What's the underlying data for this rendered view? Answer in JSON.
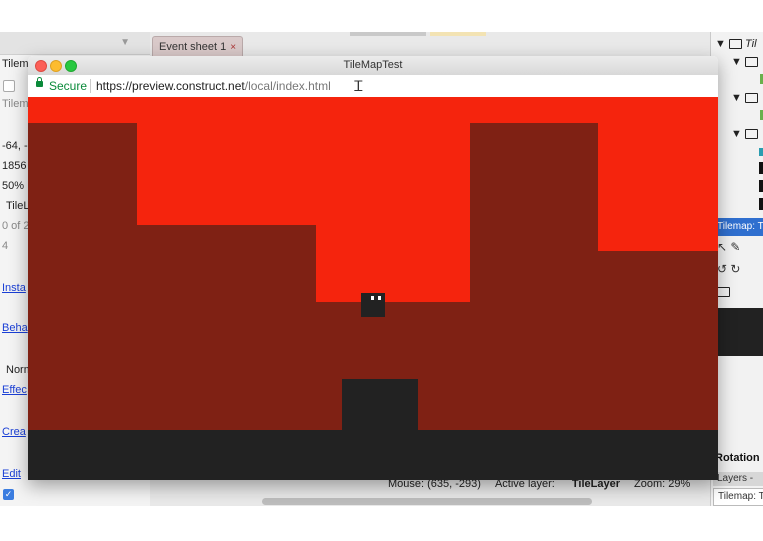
{
  "editor": {
    "left_panel": {
      "header_label": "Tilem",
      "sub_label": "Tilem",
      "rows": [
        "-64, -",
        "1856",
        "50%",
        "TileL",
        "0 of 2",
        "4"
      ],
      "links": [
        "Insta",
        "Beha",
        "Effec",
        "Crea",
        "Edit"
      ],
      "norm_label": "Norm"
    },
    "tabs": [
      {
        "label": "Event sheet 1",
        "close": "×"
      }
    ],
    "status_bar": {
      "mouse": "Mouse: (635, -293)",
      "active_layer_prefix": "Active layer: ",
      "active_layer": "TileLayer",
      "zoom": "Zoom: 29%"
    },
    "right_panel": {
      "tree_label": "Til",
      "tilemap_header": "Tilemap: T",
      "rotation_label": "Rotation",
      "layers_tab": "Layers - ",
      "tilemap_tab": "Tilemap: T"
    }
  },
  "preview_window": {
    "title": "TileMapTest",
    "secure_label": "Secure",
    "url_host": "https://preview.construct.net",
    "url_path": "/local/index.html"
  },
  "game": {
    "colors": {
      "sky": "#f5240d",
      "ground": "#7f2114",
      "dark": "#222222",
      "eyes": "#ffffff"
    }
  }
}
